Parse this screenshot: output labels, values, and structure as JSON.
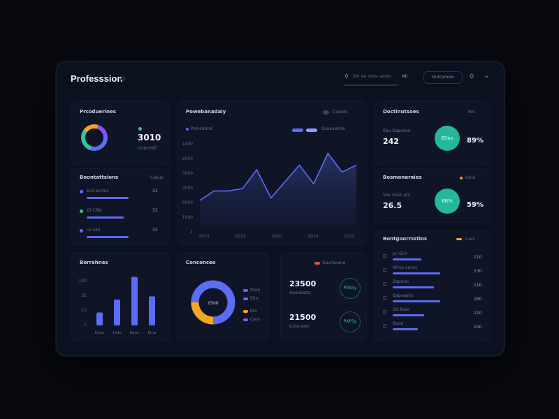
{
  "app": {
    "title": "Professsion"
  },
  "topbar": {
    "search_placeholder": "Shr eu coxs raneo",
    "badge": "Nti",
    "button_label": "Gulcpmow"
  },
  "overview": {
    "title": "Prcoduerines",
    "value": "3010",
    "sub": "cnacedl",
    "ring_colors": [
      "#5b6cf5",
      "#2ec4a6",
      "#f5a524",
      "#8a4ff5"
    ]
  },
  "breakdown": {
    "title": "Boontattsions",
    "header_right": "Caous",
    "rows": [
      {
        "label": "Ecd ecclos",
        "value": "31",
        "color": "#5b6cf5",
        "fill": 0.85
      },
      {
        "label": "Gi Cifid",
        "value": "31",
        "color": "#2ec4a6",
        "fill": 0.75
      },
      {
        "label": "ro 345",
        "value": "31",
        "color": "#5b6cf5",
        "fill": 0.85
      }
    ]
  },
  "main_chart": {
    "title": "Powebanadaiy",
    "legend_label": "Ponicalmd",
    "series_label": "Gsuevelme",
    "toggle_label": "Ciaedlc",
    "legend_colors": [
      "#5b6cf5",
      "#8aa0ff"
    ]
  },
  "chart_data": {
    "type": "area",
    "title": "Powebanadaiy",
    "y_ticks": [
      "1000",
      "2000",
      "3000",
      "4000",
      "5000",
      "1000",
      "1"
    ],
    "x_ticks": [
      "2010",
      "2013",
      "2010",
      "2010",
      "2012"
    ],
    "x": [
      0,
      1,
      2,
      3,
      4,
      5,
      6,
      7,
      8,
      9,
      10,
      11
    ],
    "values": [
      22,
      30,
      30,
      32,
      48,
      24,
      38,
      52,
      36,
      62,
      46,
      52
    ],
    "ylim": [
      0,
      70
    ],
    "color": "#5b6cf5"
  },
  "stats": [
    {
      "title": "Doctinutsoes",
      "header_right": "Rot",
      "label": "Ebu Gaprauo",
      "value": "242",
      "ring_label": "6Sov",
      "pct": "89%",
      "badge_color": ""
    },
    {
      "title": "Bosmonaraies",
      "header_right": "Isola",
      "label": "Vue Snsh ats",
      "value": "26.5",
      "ring_label": "68%",
      "pct": "59%",
      "badge_color": "#f5a524"
    }
  ],
  "list_card": {
    "title": "Bontgoorrsstios",
    "header_right": "Cact",
    "rows": [
      {
        "label": "Jui Giin",
        "value": "110",
        "fill": 0.45
      },
      {
        "label": "Miros oacoc",
        "value": "130",
        "fill": 0.75
      },
      {
        "label": "Bapoun",
        "value": "110",
        "fill": 0.65
      },
      {
        "label": "Bapoaalrs",
        "value": "160",
        "fill": 0.75
      },
      {
        "label": "Sd Boeo",
        "value": "110",
        "fill": 0.5
      },
      {
        "label": "Buon",
        "value": "100",
        "fill": 0.4
      }
    ]
  },
  "bar_card": {
    "title": "Borrahnes",
    "y_ticks": [
      "100",
      "35",
      "10",
      "1"
    ],
    "bars": [
      {
        "label": "Dcos",
        "value": 20
      },
      {
        "label": "Celo",
        "value": 40
      },
      {
        "label": "Ranc",
        "value": 75
      },
      {
        "label": "Elna",
        "value": 45
      }
    ],
    "bar_color": "#5b6cf5"
  },
  "donut_card": {
    "title": "Conconceo",
    "center_label": "0500",
    "segments": [
      {
        "label": "Dtoo",
        "value": 0.75,
        "color": "#5b6cf5"
      },
      {
        "label": "Elro",
        "value": 0.25,
        "color": "#f5a524"
      }
    ],
    "legend": [
      {
        "label": "Dtoo",
        "color": "#5b6cf5"
      },
      {
        "label": "Elro",
        "color": "#5b6cf5"
      },
      {
        "label": "Eto",
        "color": "#f5a524"
      },
      {
        "label": "Caro",
        "color": "#5b6cf5"
      }
    ]
  },
  "kpi_card": {
    "badge_label": "Gaurauene",
    "items": [
      {
        "value": "23500",
        "sub": "Ousiioetsc",
        "chip": "P0SSy"
      },
      {
        "value": "21500",
        "sub": "Cuisnarel",
        "chip": "PXP5y"
      }
    ]
  }
}
